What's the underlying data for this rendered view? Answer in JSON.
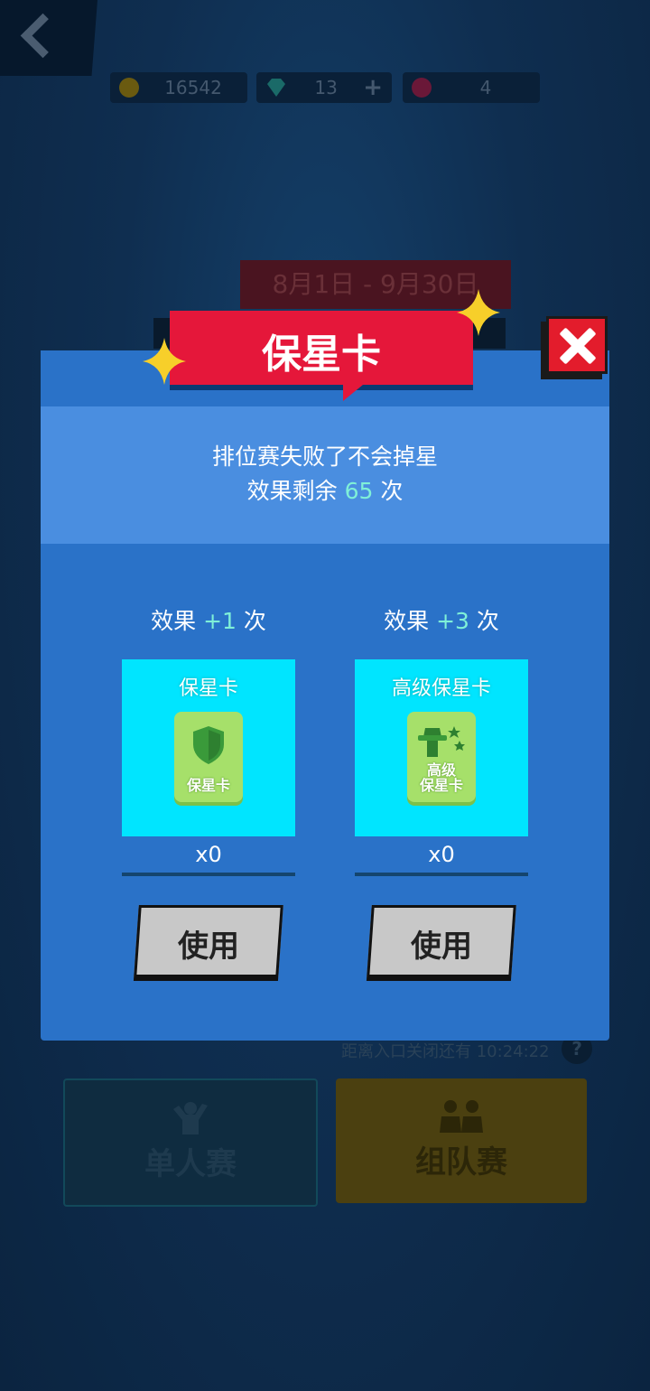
{
  "resources": [
    {
      "icon": "gold-coin-icon",
      "value": "16542",
      "has_plus": false,
      "color": "#c8a010"
    },
    {
      "icon": "diamond-icon",
      "value": "13",
      "has_plus": true,
      "plus_label": "+",
      "color": "#2ab8a8"
    },
    {
      "icon": "ticket-icon",
      "value": "4",
      "has_plus": false,
      "color": "#c02050"
    }
  ],
  "season_dates": "8月1日 - 9月30日",
  "countdown": "距离入口关闭还有 10:24:22",
  "help_label": "?",
  "modes": {
    "single": "单人赛",
    "team": "组队赛"
  },
  "dialog": {
    "title": "保星卡",
    "desc_line1": "排位赛失败了不会掉星",
    "desc_line2_prefix": "效果剩余",
    "desc_line2_value": "65",
    "desc_line2_suffix": "次",
    "accent_color": "#7ff0d8",
    "items": [
      {
        "effect_prefix": "效果",
        "effect_value": "+1",
        "effect_suffix": "次",
        "card_title": "保星卡",
        "icon_label_line1": "保星卡",
        "icon_label_line2": "",
        "count": "x0",
        "button": "使用"
      },
      {
        "effect_prefix": "效果",
        "effect_value": "+3",
        "effect_suffix": "次",
        "card_title": "高级保星卡",
        "icon_label_line1": "高级",
        "icon_label_line2": "保星卡",
        "count": "x0",
        "button": "使用"
      }
    ]
  }
}
